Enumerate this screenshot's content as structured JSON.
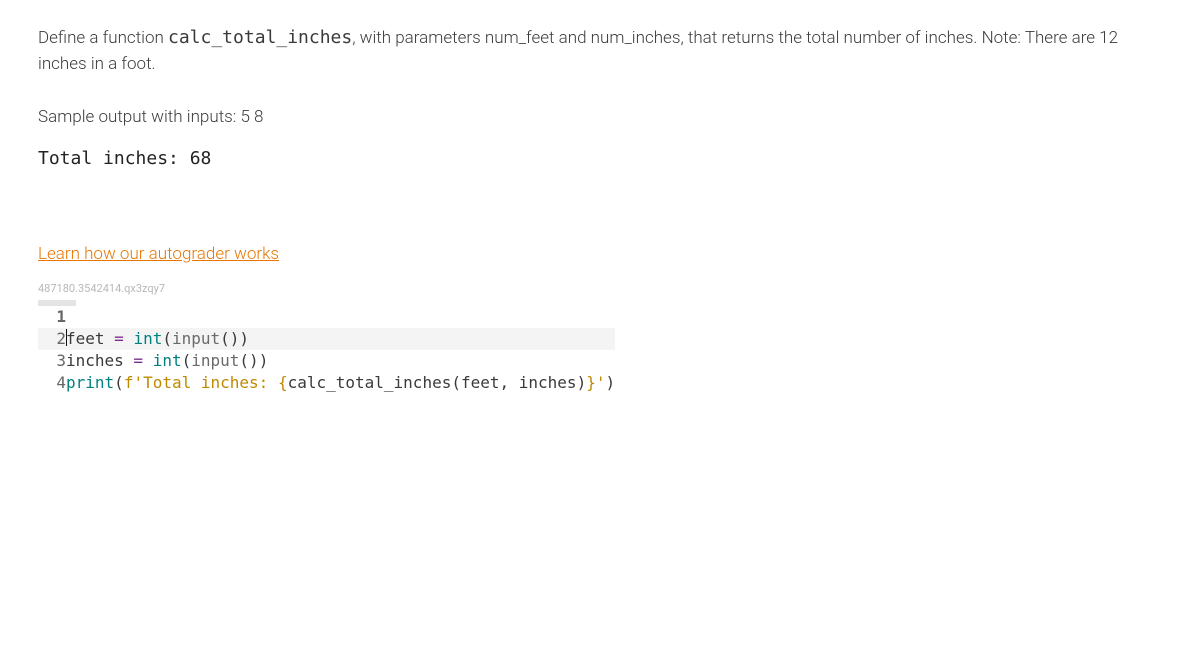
{
  "prompt": {
    "pre_code": "Define a function ",
    "code_name": "calc_total_inches",
    "post_code": ", with parameters num_feet and num_inches, that returns the total number of inches. Note: There are 12 inches in a foot."
  },
  "sample": {
    "label": "Sample output with inputs: 5 8",
    "output": "Total inches: 68"
  },
  "link": {
    "label": "Learn how our autograder works"
  },
  "qid": "487180.3542414.qx3zqy7",
  "code": {
    "lines": [
      {
        "n": "1",
        "content": ""
      },
      {
        "n": "2",
        "var1": "feet",
        "eq": " = ",
        "fn": "int",
        "p1": "(",
        "call": "input",
        "p2": "())"
      },
      {
        "n": "3",
        "var1": "inches",
        "eq": " = ",
        "fn": "int",
        "p1": "(",
        "call": "input",
        "p2": "())"
      },
      {
        "n": "4",
        "fn": "print",
        "p1": "(",
        "str_open": "f'",
        "str_text": "Total inches: ",
        "br_open": "{",
        "expr": "calc_total_inches(feet, inches)",
        "br_close": "}",
        "str_close": "'",
        "p2": ")"
      }
    ]
  }
}
